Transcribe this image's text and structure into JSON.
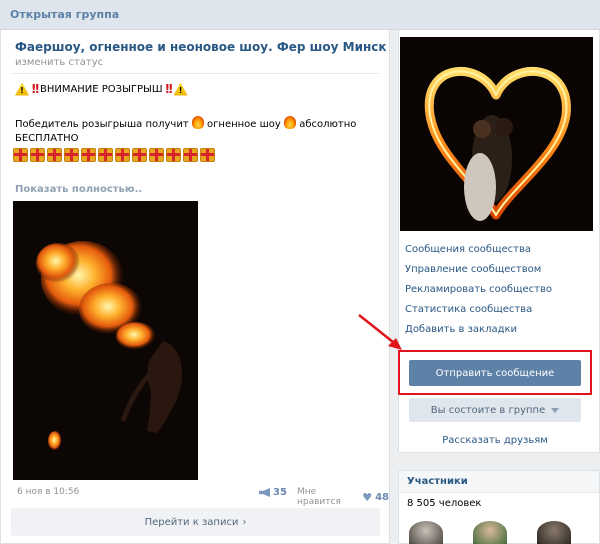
{
  "topbar": {
    "label": "Открытая группа"
  },
  "post": {
    "title": "Фаершоу, огненное и неоновое шоу. Фер шоу Минск",
    "status_edit": "изменить статус",
    "announcement": "ВНИМАНИЕ РОЗЫГРЫШ",
    "text_part1": "Победитель розыгрыша получит",
    "text_part2": "огненное шоу",
    "text_part3": "абсолютно БЕСПЛАТНО",
    "gift_count": 12,
    "show_more": "Показать полностью..",
    "date": "6 ноя в 10:56",
    "shares": "35",
    "likes_label": "Мне нравится",
    "likes": "48",
    "goto": "Перейти к записи",
    "goto_arrow": "›"
  },
  "sidebar": {
    "menu": [
      "Сообщения сообщества",
      "Управление сообществом",
      "Рекламировать сообщество",
      "Статистика сообщества",
      "Добавить в закладки"
    ],
    "send_message": "Отправить сообщение",
    "member_status": "Вы состоите в группе",
    "tell_friends": "Рассказать друзьям"
  },
  "members": {
    "title": "Участники",
    "count": "8 505 человек"
  },
  "colors": {
    "link": "#2a5885",
    "button": "#5e81a8",
    "highlight": "#e0141d",
    "background": "#edeef0"
  },
  "icons": [
    "warning-icon",
    "exclamation-icon",
    "flame-icon",
    "gift-icon",
    "megaphone-icon",
    "heart-icon",
    "chevron-down-icon",
    "red-arrow-icon"
  ]
}
